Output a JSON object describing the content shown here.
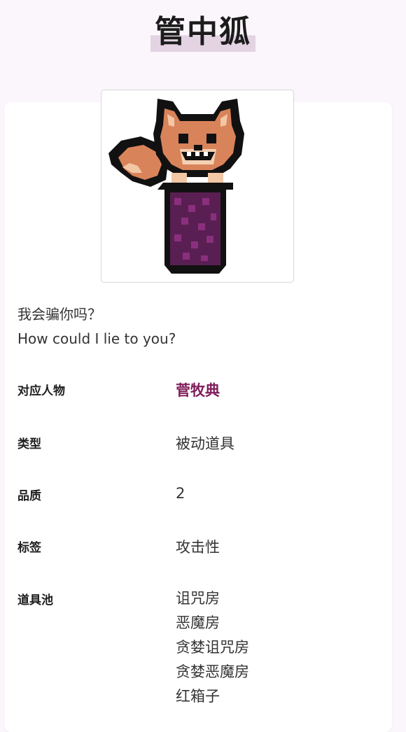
{
  "page": {
    "title": "管中狐"
  },
  "item": {
    "image_icon": "fox-in-tube-sprite",
    "quote_cn": "我会骗你吗？",
    "quote_en": "How could I lie to you?"
  },
  "attributes": {
    "character_label": "对应人物",
    "character_value": "菅牧典",
    "type_label": "类型",
    "type_value": "被动道具",
    "quality_label": "品质",
    "quality_value": "2",
    "tags_label": "标签",
    "tags_value": "攻击性",
    "pools_label": "道具池",
    "pools": [
      "诅咒房",
      "恶魔房",
      "贪婪诅咒房",
      "贪婪恶魔房",
      "红箱子"
    ]
  },
  "colors": {
    "link": "#7e1d5a",
    "title_highlight": "#e3d3e3",
    "background": "#faf6fb"
  }
}
